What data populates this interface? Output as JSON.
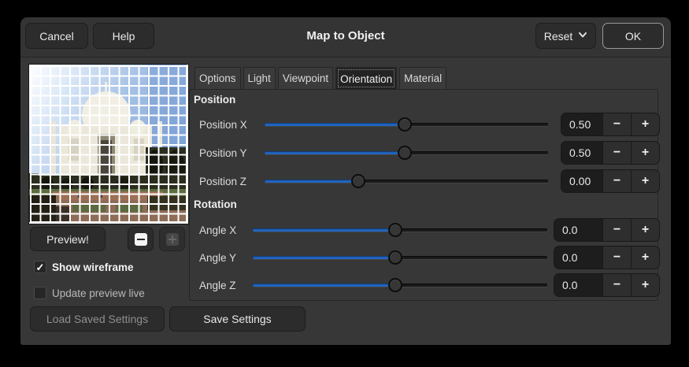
{
  "dialog": {
    "title": "Map to Object"
  },
  "header": {
    "cancel": "Cancel",
    "help": "Help",
    "reset": "Reset",
    "ok": "OK"
  },
  "tabs": [
    {
      "label": "Options",
      "active": false
    },
    {
      "label": "Light",
      "active": false
    },
    {
      "label": "Viewpoint",
      "active": false
    },
    {
      "label": "Orientation",
      "active": true
    },
    {
      "label": "Material",
      "active": false
    }
  ],
  "left": {
    "preview_button": "Preview!",
    "zoom_out_disabled": false,
    "zoom_in_disabled": true,
    "checkboxes": [
      {
        "label": "Show wireframe",
        "checked": true
      },
      {
        "label": "Update preview live",
        "checked": false
      }
    ],
    "load_button": "Load Saved Settings",
    "load_disabled": true,
    "save_button": "Save Settings"
  },
  "panel": {
    "position": {
      "heading": "Position",
      "rows": [
        {
          "label": "Position X",
          "value": "0.50",
          "percent": 49.5
        },
        {
          "label": "Position Y",
          "value": "0.50",
          "percent": 49.5
        },
        {
          "label": "Position Z",
          "value": "0.00",
          "percent": 33
        }
      ]
    },
    "rotation": {
      "heading": "Rotation",
      "rows": [
        {
          "label": "Angle X",
          "value": "0.0",
          "percent": 48.5
        },
        {
          "label": "Angle Y",
          "value": "0.0",
          "percent": 48.5
        },
        {
          "label": "Angle Z",
          "value": "0.0",
          "percent": 48.5
        }
      ]
    }
  },
  "spin": {
    "minus": "−",
    "plus": "+"
  },
  "icons": {
    "checkmark": "✓"
  },
  "colors": {
    "accent_blue": "#2165c1",
    "wireframe": "#ffffff"
  }
}
